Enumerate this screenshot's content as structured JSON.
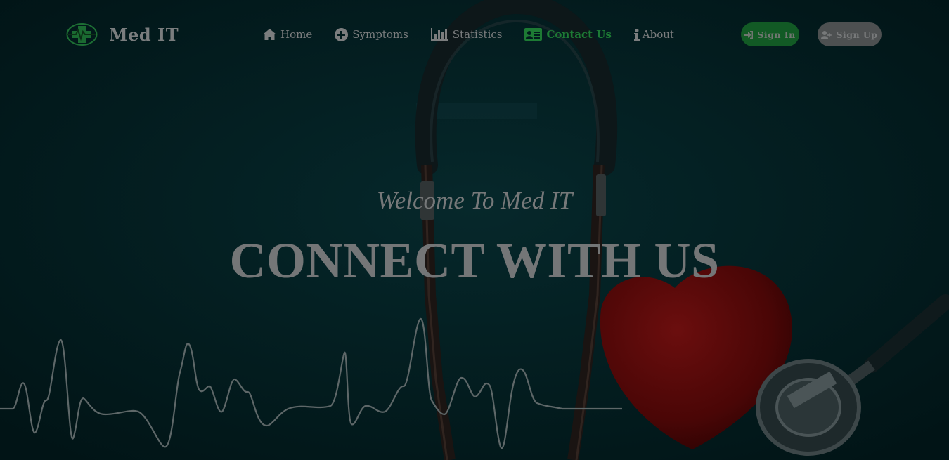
{
  "brand": {
    "name": "Med IT",
    "logo_icon": "medical-cross-heartbeat-icon"
  },
  "nav": {
    "items": [
      {
        "label": "Home",
        "icon": "home-icon"
      },
      {
        "label": "Symptoms",
        "icon": "plus-circle-icon"
      },
      {
        "label": "Statistics",
        "icon": "bar-chart-icon"
      },
      {
        "label": "Contact Us",
        "icon": "id-card-icon",
        "active": true
      },
      {
        "label": "About",
        "icon": "info-icon"
      }
    ]
  },
  "auth": {
    "sign_in": "Sign In",
    "sign_up": "Sign Up",
    "sign_in_icon": "sign-in-icon",
    "sign_up_icon": "user-plus-icon"
  },
  "hero": {
    "welcome": "Welcome To Med IT",
    "headline": "CONNECT WITH US"
  },
  "colors": {
    "overlay": "#01191b",
    "active_nav": "#1d7a34",
    "sign_in_bg": "#125a25",
    "sign_up_bg": "#4d5051",
    "heart": "#5a0a0b"
  }
}
